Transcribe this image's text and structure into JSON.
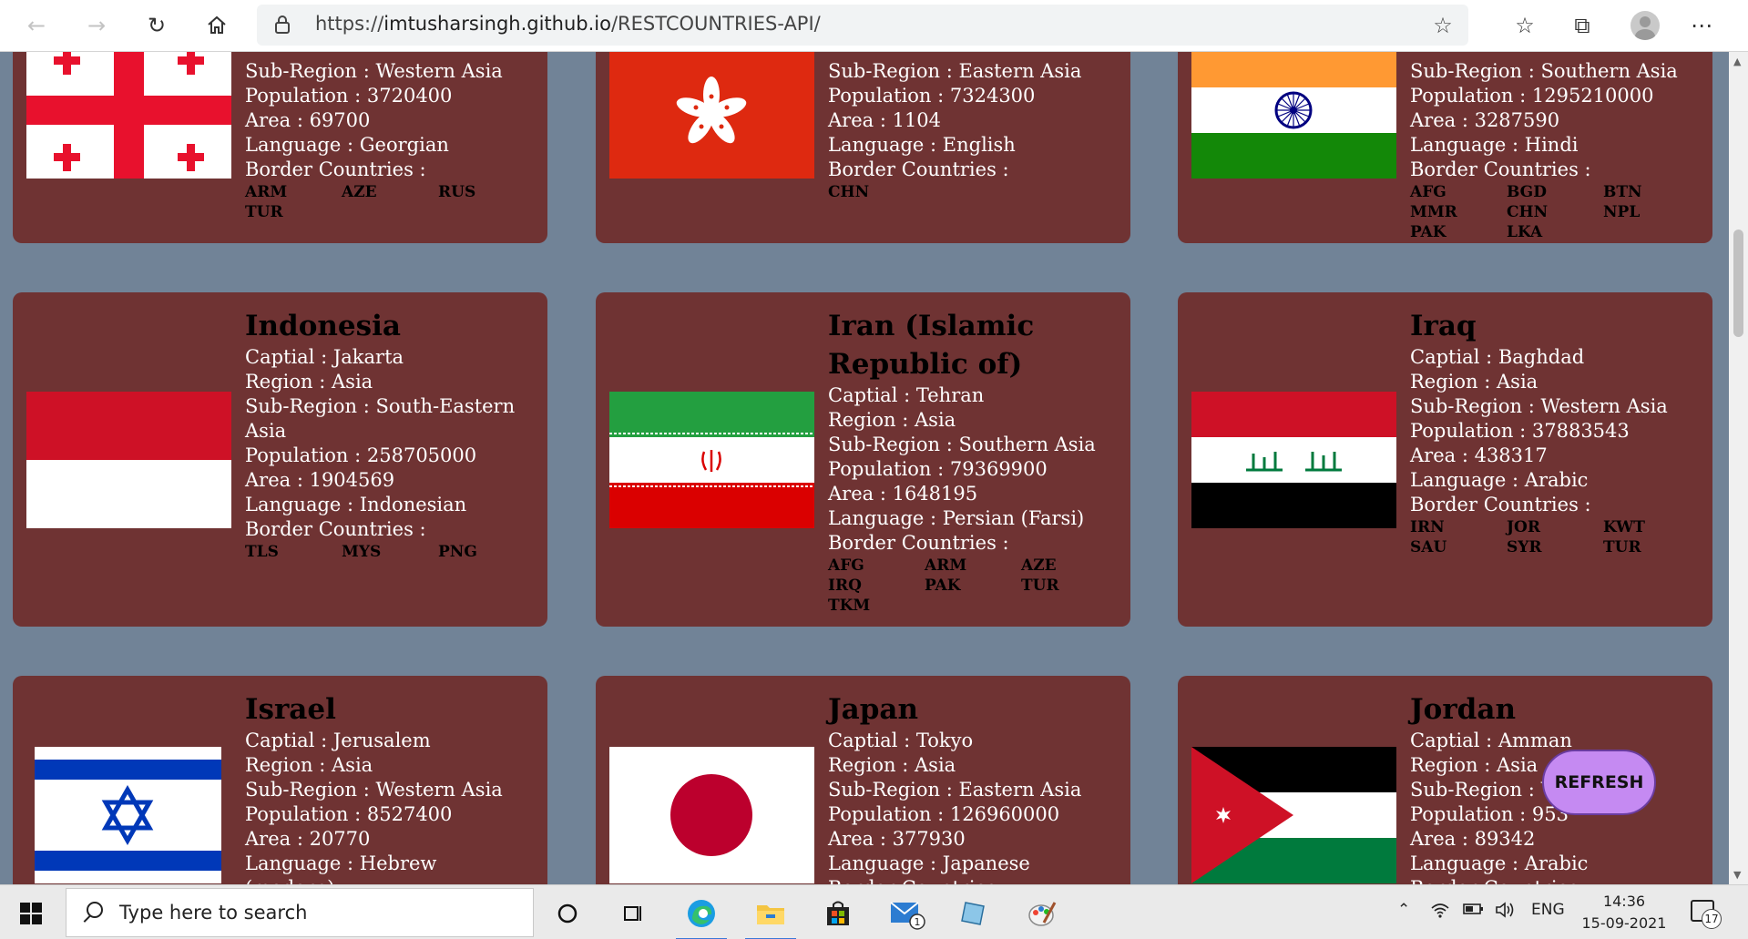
{
  "browser": {
    "url_prefix": "https://",
    "url_host": "imtusharsingh.github.io",
    "url_path": "/RESTCOUNTRIES-API/"
  },
  "labels": {
    "capital": "Captial : ",
    "region": "Region : ",
    "subregion": "Sub-Region : ",
    "population": "Population : ",
    "area": "Area : ",
    "language": "Language : ",
    "borders": "Border Countries :"
  },
  "cards": [
    {
      "name": "",
      "subregion": "Western Asia",
      "population": "3720400",
      "area": "69700",
      "language": "Georgian",
      "borders": [
        "ARM",
        "AZE",
        "RUS",
        "TUR"
      ],
      "flag": "georgia-flag"
    },
    {
      "name": "",
      "subregion": "Eastern Asia",
      "population": "7324300",
      "area": "1104",
      "language": "English",
      "borders": [
        "CHN"
      ],
      "flag": "hong-kong-flag"
    },
    {
      "name": "",
      "subregion": "Southern Asia",
      "population": "1295210000",
      "area": "3287590",
      "language": "Hindi",
      "borders": [
        "AFG",
        "BGD",
        "BTN",
        "MMR",
        "CHN",
        "NPL",
        "PAK",
        "LKA"
      ],
      "flag": "india-flag"
    },
    {
      "name": "Indonesia",
      "capital": "Jakarta",
      "region": "Asia",
      "subregion": "South-Eastern Asia",
      "population": "258705000",
      "area": "1904569",
      "language": "Indonesian",
      "borders": [
        "TLS",
        "MYS",
        "PNG"
      ],
      "flag": "indonesia-flag"
    },
    {
      "name": "Iran (Islamic Republic of)",
      "capital": "Tehran",
      "region": "Asia",
      "subregion": "Southern Asia",
      "population": "79369900",
      "area": "1648195",
      "language": "Persian (Farsi)",
      "borders": [
        "AFG",
        "ARM",
        "AZE",
        "IRQ",
        "PAK",
        "TUR",
        "TKM"
      ],
      "flag": "iran-flag"
    },
    {
      "name": "Iraq",
      "capital": "Baghdad",
      "region": "Asia",
      "subregion": "Western Asia",
      "population": "37883543",
      "area": "438317",
      "language": "Arabic",
      "borders": [
        "IRN",
        "JOR",
        "KWT",
        "SAU",
        "SYR",
        "TUR"
      ],
      "flag": "iraq-flag"
    },
    {
      "name": "Israel",
      "capital": "Jerusalem",
      "region": "Asia",
      "subregion": "Western Asia",
      "population": "8527400",
      "area": "20770",
      "language": "Hebrew (modern)",
      "flag": "israel-flag"
    },
    {
      "name": "Japan",
      "capital": "Tokyo",
      "region": "Asia",
      "subregion": "Eastern Asia",
      "population": "126960000",
      "area": "377930",
      "language": "Japanese",
      "flag": "japan-flag"
    },
    {
      "name": "Jordan",
      "capital": "Amman",
      "region": "Asia",
      "subregion": "W",
      "population": "953",
      "area": "89342",
      "language": "Arabic",
      "flag": "jordan-flag"
    }
  ],
  "refresh_label": "REFRESH",
  "taskbar": {
    "search_placeholder": "Type here to search",
    "language": "ENG",
    "time": "14:36",
    "date": "15-09-2021",
    "mail_badge": "1",
    "notification_count": "17"
  }
}
